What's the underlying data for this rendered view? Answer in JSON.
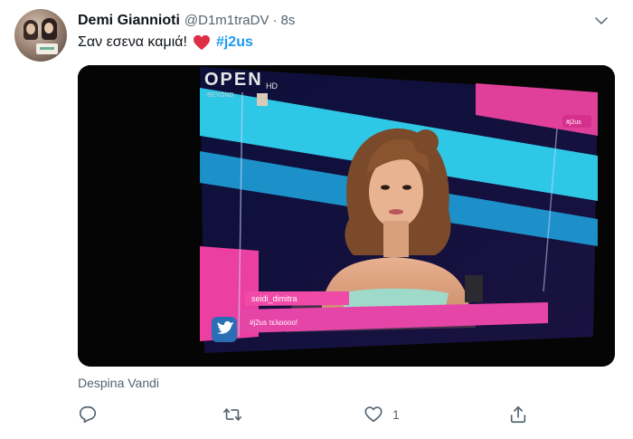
{
  "tweet": {
    "author_name": "Demi Giannioti",
    "handle": "@D1m1traDV",
    "separator": "·",
    "time": "8s",
    "text_main": "Σαν εσενα καμιά!",
    "hashtag": "#j2us",
    "media_caption": "Despina Vandi"
  },
  "tv_screen": {
    "channel_logo": "OPEN",
    "channel_hd": "HD",
    "channel_sub": "BEYOND",
    "corner_tag": "#j2us",
    "comment_user": "seidi_dimitra",
    "comment_text": "#j2us τελειοοο!"
  },
  "actions": {
    "reply_icon": "reply-icon",
    "retweet_icon": "retweet-icon",
    "like_icon": "heart-icon",
    "like_count": "1",
    "share_icon": "share-icon"
  },
  "colors": {
    "accent": "#1d9bf0",
    "secondary_text": "#536471",
    "heart": "#e0245e"
  }
}
